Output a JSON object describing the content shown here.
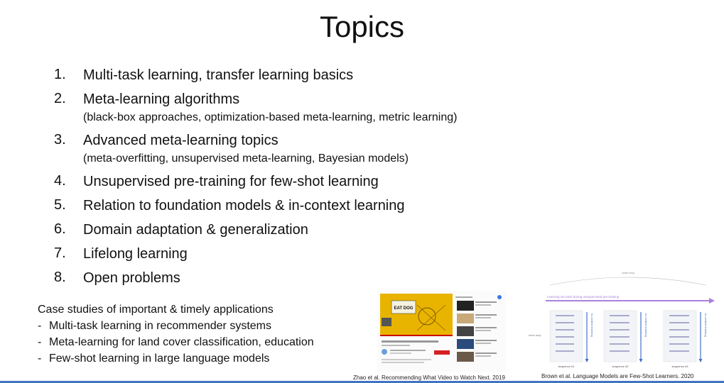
{
  "slide": {
    "title": "Topics",
    "topics": [
      {
        "num": "1.",
        "text": "Multi-task learning, transfer learning basics",
        "sub": ""
      },
      {
        "num": "2.",
        "text": "Meta-learning algorithms",
        "sub": "(black-box approaches, optimization-based meta-learning, metric learning)"
      },
      {
        "num": "3.",
        "text": "Advanced meta-learning topics",
        "sub": "(meta-overfitting, unsupervised meta-learning, Bayesian models)"
      },
      {
        "num": "4.",
        "text": "Unsupervised pre-training for few-shot learning",
        "sub": ""
      },
      {
        "num": "5.",
        "text": "Relation to foundation models & in-context learning",
        "sub": ""
      },
      {
        "num": "6.",
        "text": "Domain adaptation & generalization",
        "sub": ""
      },
      {
        "num": "7.",
        "text": "Lifelong learning",
        "sub": ""
      },
      {
        "num": "8.",
        "text": "Open problems",
        "sub": ""
      }
    ],
    "case_studies": {
      "heading": "Case studies of important & timely applications",
      "bullet": "-",
      "items": [
        "Multi-task learning in recommender systems",
        "Meta-learning for land cover classification, education",
        "Few-shot learning in large language models"
      ]
    },
    "figures": {
      "left": {
        "caption": "Zhao et al. Recommending What Video to Watch Next. 2019",
        "video_overlay_text": "EAT DOG"
      },
      "right": {
        "caption": "Brown et al. Language Models are Few-Shot Learners. 2020",
        "top_label": "outer loop",
        "arrow_label": "Learning via SGD during unsupervised pre-training",
        "inner_loop_label": "inner loop",
        "column_label": "in-context learning",
        "sequences": [
          "sequence #1",
          "sequence #2",
          "sequence #3"
        ]
      }
    },
    "colors": {
      "accent_blue": "#4472c4",
      "arrow_purple": "#a97fe0",
      "video_yellow": "#e8b400"
    }
  }
}
